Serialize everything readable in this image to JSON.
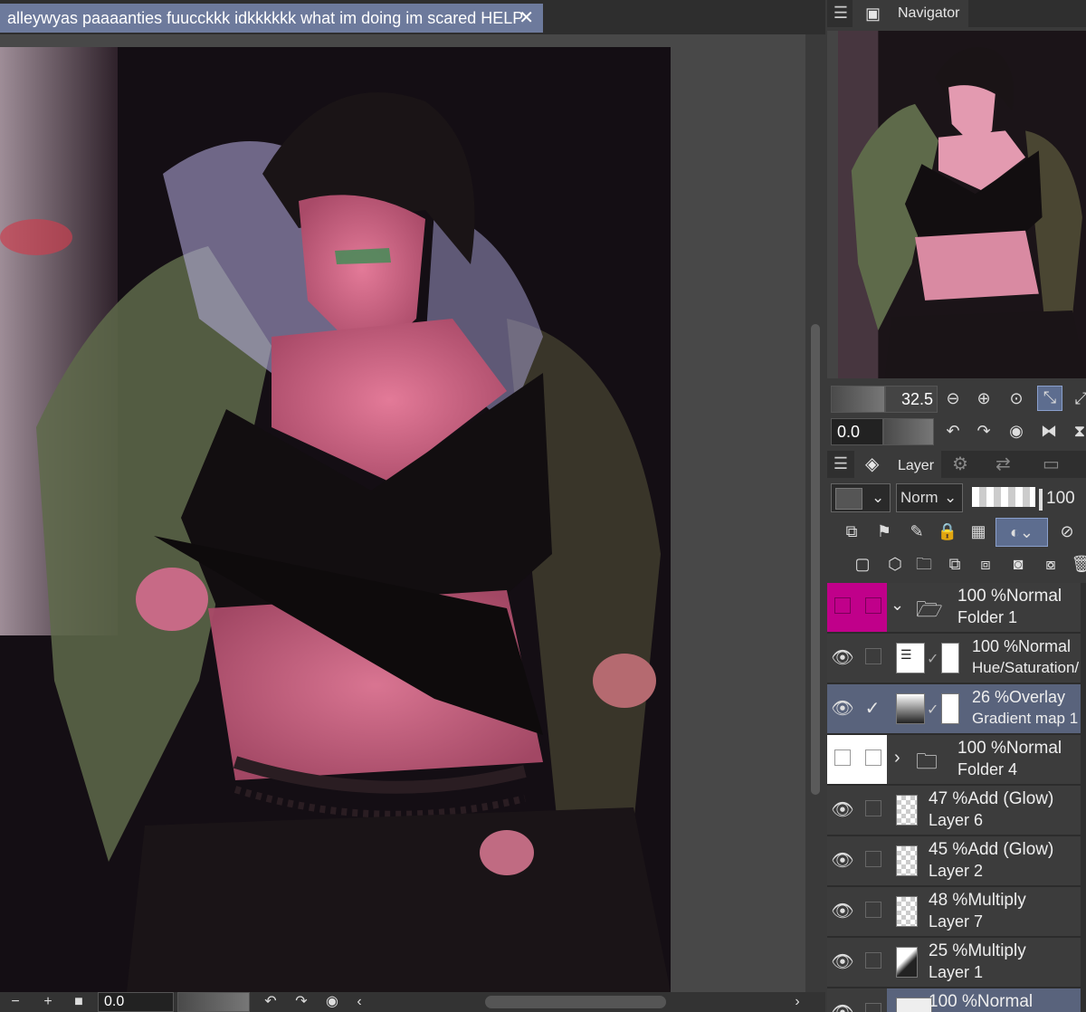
{
  "document": {
    "tab_title": "alleywyas paaaanties fuucckkk idkkkkkk what im doing im scared HELP",
    "close_glyph": "✕"
  },
  "navigator": {
    "title": "Navigator",
    "zoom": "32.5",
    "rotation": "0.0"
  },
  "layer_panel": {
    "title": "Layer",
    "blend_mode": "Norm",
    "opacity": "100"
  },
  "layers": [
    {
      "opacity": "100 %",
      "mode": "Normal",
      "name": "Folder 1",
      "type": "folder",
      "expanded": true,
      "visible": false,
      "color_tag": "#c0008a"
    },
    {
      "opacity": "100 %",
      "mode": "Normal",
      "name": "Hue/Saturation/",
      "type": "adjustment",
      "visible": true
    },
    {
      "opacity": "26 %",
      "mode": "Overlay",
      "name": "Gradient map 1",
      "type": "adjustment",
      "visible": true,
      "selected": true
    },
    {
      "opacity": "100 %",
      "mode": "Normal",
      "name": "Folder 4",
      "type": "folder",
      "expanded": false,
      "visible": false
    },
    {
      "opacity": "47 %",
      "mode": "Add (Glow)",
      "name": "Layer 6",
      "type": "raster",
      "visible": true
    },
    {
      "opacity": "45 %",
      "mode": "Add (Glow)",
      "name": "Layer 2",
      "type": "raster",
      "visible": true
    },
    {
      "opacity": "48 %",
      "mode": "Multiply",
      "name": "Layer 7",
      "type": "raster",
      "visible": true
    },
    {
      "opacity": "25 %",
      "mode": "Multiply",
      "name": "Layer 1",
      "type": "raster",
      "visible": true
    },
    {
      "opacity": "100 %",
      "mode": "Normal",
      "name": "",
      "type": "raster",
      "visible": true,
      "selected": true
    }
  ],
  "status_bar": {
    "rotation": "0.0"
  },
  "icons": {
    "eye": "eye-icon",
    "folder": "folder-icon",
    "check": "check-icon"
  }
}
